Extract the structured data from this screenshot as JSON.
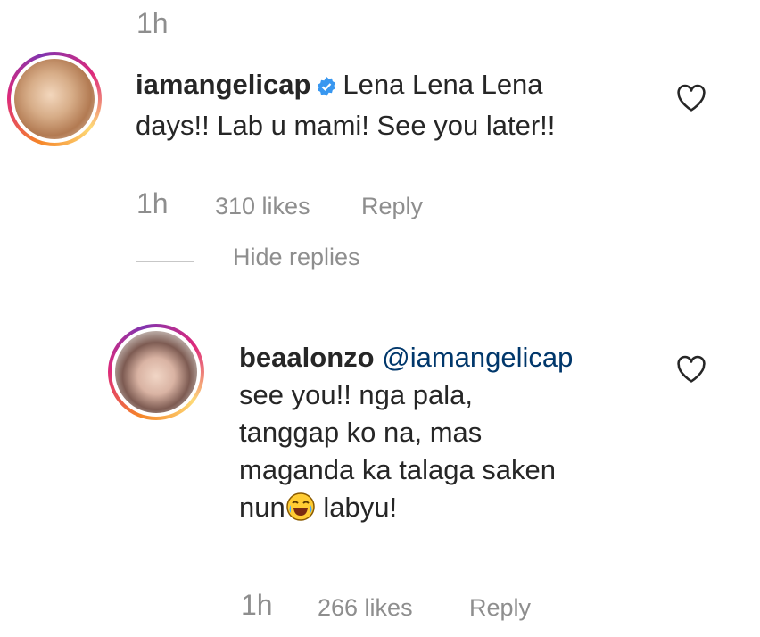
{
  "top_time": "1h",
  "comment": {
    "username": "iamangelicap",
    "line1": "Lena Lena Lena",
    "line2": "days!! Lab u mami! See you later!!",
    "time": "1h",
    "likes": "310 likes",
    "reply": "Reply"
  },
  "hide_replies": "Hide replies",
  "reply_comment": {
    "username": "beaalonzo",
    "mention": "@iamangelicap",
    "line1": "see you!! nga pala,",
    "line2": "tanggap ko na, mas",
    "line3": "maganda ka talaga saken",
    "line4_prefix": "nun",
    "line4_suffix": " labyu!",
    "emoji": "face-with-tears-of-joy",
    "time": "1h",
    "likes": "266 likes",
    "reply": "Reply"
  },
  "icons": {
    "verified": "verified-badge-icon",
    "heart": "heart-outline-icon"
  },
  "colors": {
    "secondary_text": "#8e8e8e",
    "mention": "#00376b",
    "verified": "#3897f0"
  }
}
